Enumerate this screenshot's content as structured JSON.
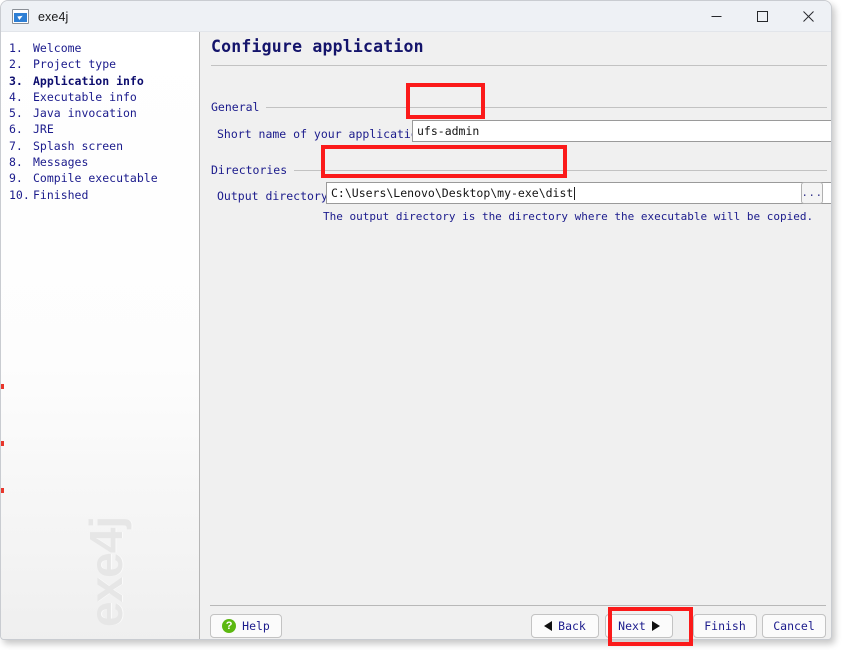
{
  "window": {
    "title": "exe4j",
    "app_icon": "exe4j-app-icon",
    "controls": {
      "minimize": "minimize-icon",
      "maximize": "maximize-icon",
      "close": "close-icon"
    }
  },
  "sidebar": {
    "watermark": "exe4j",
    "steps": [
      {
        "num": "1.",
        "label": "Welcome",
        "current": false
      },
      {
        "num": "2.",
        "label": "Project type",
        "current": false
      },
      {
        "num": "3.",
        "label": "Application info",
        "current": true
      },
      {
        "num": "4.",
        "label": "Executable info",
        "current": false
      },
      {
        "num": "5.",
        "label": "Java invocation",
        "current": false
      },
      {
        "num": "6.",
        "label": "JRE",
        "current": false
      },
      {
        "num": "7.",
        "label": "Splash screen",
        "current": false
      },
      {
        "num": "8.",
        "label": "Messages",
        "current": false
      },
      {
        "num": "9.",
        "label": "Compile executable",
        "current": false
      },
      {
        "num": "10.",
        "label": "Finished",
        "current": false
      }
    ]
  },
  "main": {
    "page_title": "Configure application",
    "groups": {
      "general": {
        "title": "General",
        "short_name": {
          "label": "Short name of your application:",
          "value": "ufs-admin",
          "placeholder": ""
        }
      },
      "directories": {
        "title": "Directories",
        "output_directory": {
          "label": "Output directory",
          "value": "C:\\Users\\Lenovo\\Desktop\\my-exe\\dist",
          "placeholder": "",
          "browse_label": "...",
          "hint": "The output directory is the directory where the executable will be copied."
        }
      }
    }
  },
  "buttons": {
    "help": {
      "label": "Help",
      "icon": "help-question-icon"
    },
    "back": {
      "label": "Back",
      "icon": "triangle-left-icon"
    },
    "next": {
      "label": "Next",
      "icon": "triangle-right-icon"
    },
    "finish": {
      "label": "Finish"
    },
    "cancel": {
      "label": "Cancel"
    }
  },
  "annotations": {
    "accent_color": "#fb1a1a",
    "highlighted": [
      "short-name-field",
      "output-directory-field",
      "next-button"
    ]
  }
}
